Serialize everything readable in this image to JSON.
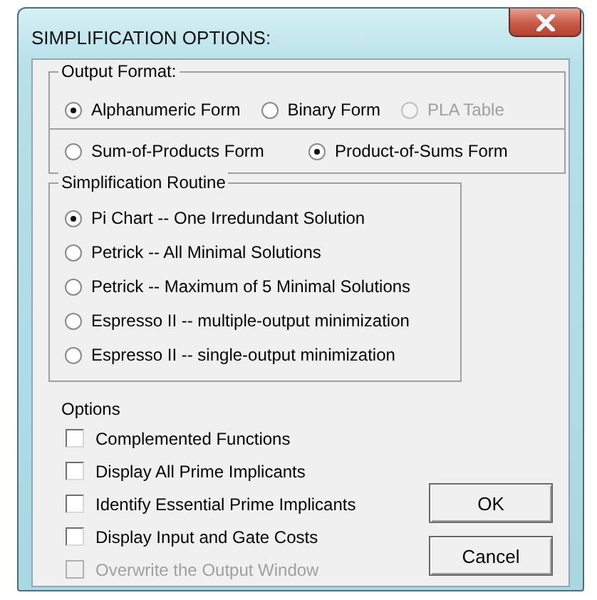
{
  "window": {
    "title": "SIMPLIFICATION OPTIONS:"
  },
  "output_format": {
    "label": "Output Format:",
    "format_options": [
      {
        "label": "Alphanumeric Form",
        "selected": true,
        "disabled": false
      },
      {
        "label": "Binary Form",
        "selected": false,
        "disabled": false
      },
      {
        "label": "PLA Table",
        "selected": false,
        "disabled": true
      }
    ],
    "form_options": [
      {
        "label": "Sum-of-Products Form",
        "selected": false,
        "disabled": false
      },
      {
        "label": "Product-of-Sums Form",
        "selected": true,
        "disabled": false
      }
    ]
  },
  "simplification_routine": {
    "label": "Simplification Routine",
    "options": [
      {
        "label": "Pi Chart -- One Irredundant Solution",
        "selected": true,
        "disabled": false
      },
      {
        "label": "Petrick -- All Minimal Solutions",
        "selected": false,
        "disabled": false
      },
      {
        "label": "Petrick -- Maximum of 5 Minimal Solutions",
        "selected": false,
        "disabled": false
      },
      {
        "label": "Espresso II -- multiple-output minimization",
        "selected": false,
        "disabled": false
      },
      {
        "label": "Espresso II -- single-output minimization",
        "selected": false,
        "disabled": false
      }
    ]
  },
  "options": {
    "label": "Options",
    "checkboxes": [
      {
        "label": "Complemented Functions",
        "checked": false,
        "disabled": false
      },
      {
        "label": "Display All Prime Implicants",
        "checked": false,
        "disabled": false
      },
      {
        "label": "Identify Essential Prime Implicants",
        "checked": false,
        "disabled": false
      },
      {
        "label": "Display Input and Gate Costs",
        "checked": false,
        "disabled": false
      },
      {
        "label": "Overwrite the Output Window",
        "checked": false,
        "disabled": true
      }
    ]
  },
  "buttons": [
    "OK",
    "Cancel"
  ]
}
